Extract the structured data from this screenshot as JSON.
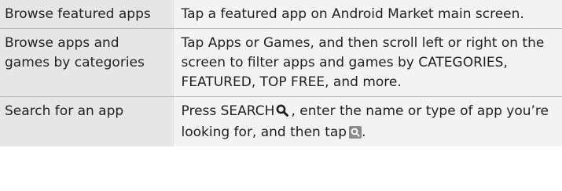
{
  "rows": [
    {
      "action": "Browse featured apps",
      "description": "Tap a featured app on Android Market main screen."
    },
    {
      "action": "Browse apps and games by categories",
      "desc_tap": "Tap",
      "desc_apps": "Apps",
      "desc_or": "or",
      "desc_games": "Games",
      "desc_mid": ", and then scroll left or right on the screen to filter apps and games by",
      "desc_categories": "CATEGORIES",
      "desc_featured": "FEATURED",
      "desc_top_free": "TOP FREE",
      "desc_end": ", and more."
    },
    {
      "action": "Search for an app",
      "desc_press": "Press SEARCH",
      "desc_middle": ", enter the name or type of app you’re looking for, and then tap",
      "desc_period": "."
    }
  ],
  "icons": {
    "search": "magnifier-icon",
    "search_button": "search-button-icon"
  },
  "colors": {
    "left_cell_bg": "#e6e6e6",
    "right_cell_bg": "#f3f3f3",
    "icon_box_bg": "#8a8a8a"
  }
}
